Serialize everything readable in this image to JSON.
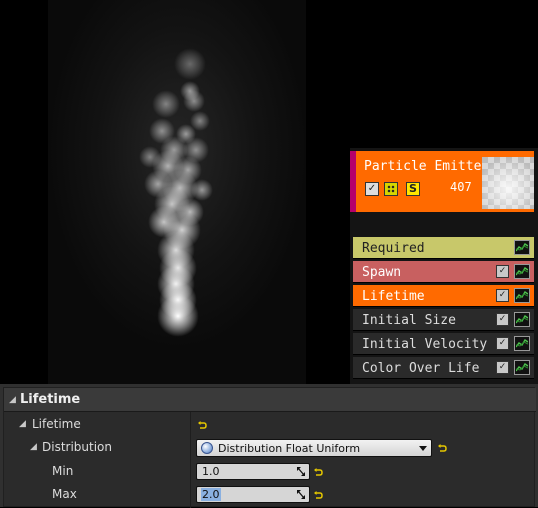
{
  "emitter": {
    "title": "Particle Emitter",
    "particle_count": "407",
    "solo_label": "S",
    "modules": [
      {
        "label": "Required",
        "bg": "#c8c86a",
        "fg": "#222222",
        "has_check": false
      },
      {
        "label": "Spawn",
        "bg": "#c86060",
        "fg": "#ffffff",
        "has_check": true
      },
      {
        "label": "Lifetime",
        "bg": "#ff6a00",
        "fg": "#ffffff",
        "has_check": true
      },
      {
        "label": "Initial Size",
        "bg": "#2a2a2a",
        "fg": "#dddddd",
        "has_check": true
      },
      {
        "label": "Initial Velocity",
        "bg": "#2a2a2a",
        "fg": "#dddddd",
        "has_check": true
      },
      {
        "label": "Color Over Life",
        "bg": "#2a2a2a",
        "fg": "#dddddd",
        "has_check": true
      }
    ]
  },
  "details": {
    "section_title": "Lifetime",
    "rows": {
      "lifetime_label": "Lifetime",
      "distribution_label": "Distribution",
      "distribution_value": "Distribution Float Uniform",
      "min_label": "Min",
      "min_value": "1.0",
      "max_label": "Max",
      "max_value": "2.0"
    }
  },
  "colors": {
    "emitter_header": "#ff6a00",
    "emitter_stripe": "#b5006b",
    "reset_arrow": "#e6c800"
  }
}
